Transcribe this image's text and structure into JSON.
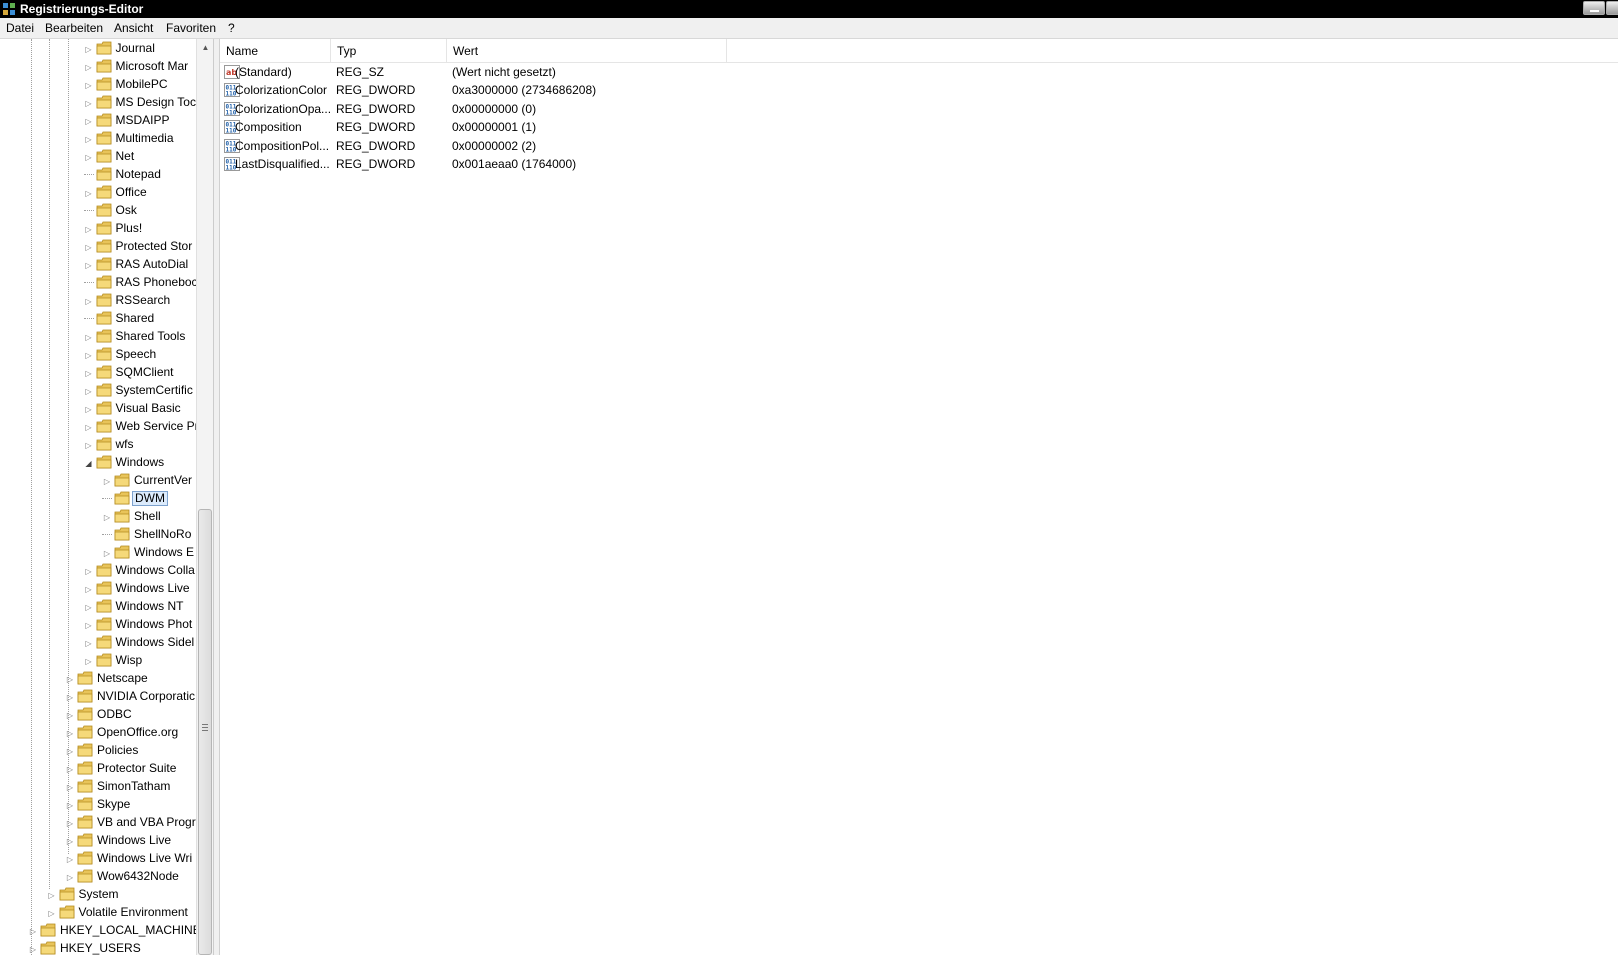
{
  "window": {
    "title": "Registrierungs-Editor"
  },
  "menu": {
    "items": [
      "Datei",
      "Bearbeiten",
      "Ansicht",
      "Favoriten",
      "?"
    ]
  },
  "tree": {
    "rows": [
      {
        "label": "Journal",
        "level": 4,
        "expander": "collapsed"
      },
      {
        "label": "Microsoft Mar",
        "level": 4,
        "expander": "collapsed"
      },
      {
        "label": "MobilePC",
        "level": 4,
        "expander": "collapsed"
      },
      {
        "label": "MS Design Toc",
        "level": 4,
        "expander": "collapsed"
      },
      {
        "label": "MSDAIPP",
        "level": 4,
        "expander": "collapsed"
      },
      {
        "label": "Multimedia",
        "level": 4,
        "expander": "collapsed"
      },
      {
        "label": "Net",
        "level": 4,
        "expander": "collapsed"
      },
      {
        "label": "Notepad",
        "level": 4,
        "expander": "none"
      },
      {
        "label": "Office",
        "level": 4,
        "expander": "collapsed"
      },
      {
        "label": "Osk",
        "level": 4,
        "expander": "none"
      },
      {
        "label": "Plus!",
        "level": 4,
        "expander": "collapsed"
      },
      {
        "label": "Protected Stor",
        "level": 4,
        "expander": "collapsed"
      },
      {
        "label": "RAS AutoDial",
        "level": 4,
        "expander": "collapsed"
      },
      {
        "label": "RAS Phoneboc",
        "level": 4,
        "expander": "none"
      },
      {
        "label": "RSSearch",
        "level": 4,
        "expander": "collapsed"
      },
      {
        "label": "Shared",
        "level": 4,
        "expander": "none"
      },
      {
        "label": "Shared Tools",
        "level": 4,
        "expander": "collapsed"
      },
      {
        "label": "Speech",
        "level": 4,
        "expander": "collapsed"
      },
      {
        "label": "SQMClient",
        "level": 4,
        "expander": "collapsed"
      },
      {
        "label": "SystemCertific",
        "level": 4,
        "expander": "collapsed"
      },
      {
        "label": "Visual Basic",
        "level": 4,
        "expander": "collapsed"
      },
      {
        "label": "Web Service Pr",
        "level": 4,
        "expander": "collapsed"
      },
      {
        "label": "wfs",
        "level": 4,
        "expander": "collapsed"
      },
      {
        "label": "Windows",
        "level": 4,
        "expander": "expanded"
      },
      {
        "label": "CurrentVer",
        "level": 5,
        "expander": "collapsed"
      },
      {
        "label": "DWM",
        "level": 5,
        "expander": "none",
        "selected": true
      },
      {
        "label": "Shell",
        "level": 5,
        "expander": "collapsed"
      },
      {
        "label": "ShellNoRo",
        "level": 5,
        "expander": "none"
      },
      {
        "label": "Windows E",
        "level": 5,
        "expander": "collapsed"
      },
      {
        "label": "Windows Colla",
        "level": 4,
        "expander": "collapsed"
      },
      {
        "label": "Windows Live",
        "level": 4,
        "expander": "collapsed"
      },
      {
        "label": "Windows NT",
        "level": 4,
        "expander": "collapsed"
      },
      {
        "label": "Windows Phot",
        "level": 4,
        "expander": "collapsed"
      },
      {
        "label": "Windows Sidel",
        "level": 4,
        "expander": "collapsed"
      },
      {
        "label": "Wisp",
        "level": 4,
        "expander": "collapsed"
      },
      {
        "label": "Netscape",
        "level": 3,
        "expander": "collapsed"
      },
      {
        "label": "NVIDIA Corporatic",
        "level": 3,
        "expander": "collapsed"
      },
      {
        "label": "ODBC",
        "level": 3,
        "expander": "collapsed"
      },
      {
        "label": "OpenOffice.org",
        "level": 3,
        "expander": "collapsed"
      },
      {
        "label": "Policies",
        "level": 3,
        "expander": "collapsed"
      },
      {
        "label": "Protector Suite",
        "level": 3,
        "expander": "collapsed"
      },
      {
        "label": "SimonTatham",
        "level": 3,
        "expander": "collapsed"
      },
      {
        "label": "Skype",
        "level": 3,
        "expander": "collapsed"
      },
      {
        "label": "VB and VBA Progr",
        "level": 3,
        "expander": "collapsed"
      },
      {
        "label": "Windows Live",
        "level": 3,
        "expander": "collapsed"
      },
      {
        "label": "Windows Live Wri",
        "level": 3,
        "expander": "collapsed"
      },
      {
        "label": "Wow6432Node",
        "level": 3,
        "expander": "collapsed"
      },
      {
        "label": "System",
        "level": 2,
        "expander": "collapsed"
      },
      {
        "label": "Volatile Environment",
        "level": 2,
        "expander": "collapsed"
      },
      {
        "label": "HKEY_LOCAL_MACHINE",
        "level": 1,
        "expander": "collapsed"
      },
      {
        "label": "HKEY_USERS",
        "level": 1,
        "expander": "collapsed"
      }
    ]
  },
  "list": {
    "columns": [
      "Name",
      "Typ",
      "Wert"
    ],
    "rows": [
      {
        "icon": "string-value-icon",
        "name": "(Standard)",
        "type": "REG_SZ",
        "value": "(Wert nicht gesetzt)"
      },
      {
        "icon": "dword-value-icon",
        "name": "ColorizationColor",
        "type": "REG_DWORD",
        "value": "0xa3000000 (2734686208)"
      },
      {
        "icon": "dword-value-icon",
        "name": "ColorizationOpa...",
        "type": "REG_DWORD",
        "value": "0x00000000 (0)"
      },
      {
        "icon": "dword-value-icon",
        "name": "Composition",
        "type": "REG_DWORD",
        "value": "0x00000001 (1)"
      },
      {
        "icon": "dword-value-icon",
        "name": "CompositionPol...",
        "type": "REG_DWORD",
        "value": "0x00000002 (2)"
      },
      {
        "icon": "dword-value-icon",
        "name": "LastDisqualified...",
        "type": "REG_DWORD",
        "value": "0x001aeaa0 (1764000)"
      }
    ]
  },
  "colors": {
    "titlebar": "#000000",
    "selection": "#dcebfc",
    "selection_border": "#7da2ce",
    "folder": "#e8c45a"
  }
}
